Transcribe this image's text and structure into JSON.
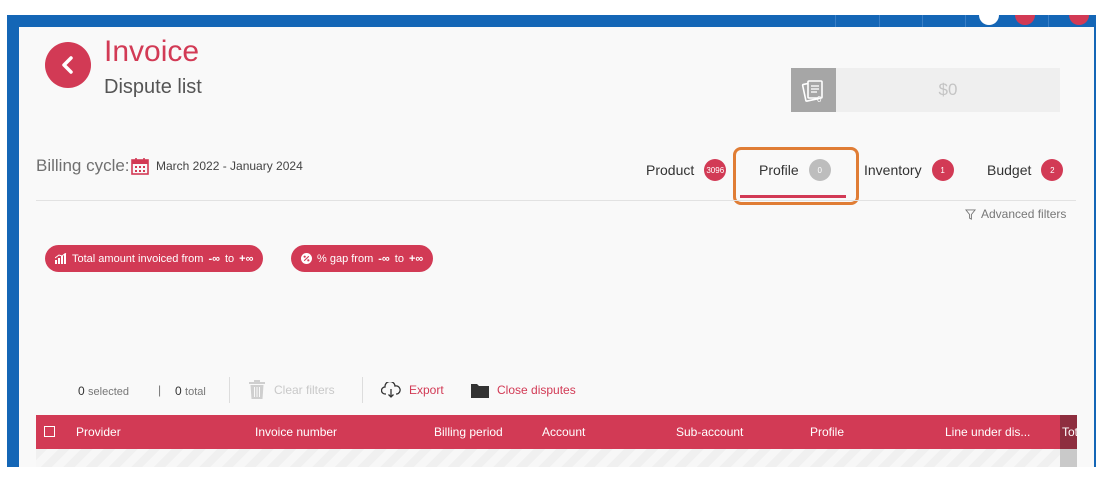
{
  "header": {
    "title": "Invoice",
    "subtitle": "Dispute list",
    "amount": "$0",
    "amount_icon_count": "0"
  },
  "billing": {
    "label": "Billing cycle:",
    "value": "March 2022 - January 2024"
  },
  "tabs": [
    {
      "label": "Product",
      "badge": "3096",
      "active": false
    },
    {
      "label": "Profile",
      "badge": "0",
      "active": true
    },
    {
      "label": "Inventory",
      "badge": "1",
      "active": false
    },
    {
      "label": "Budget",
      "badge": "2",
      "active": false
    }
  ],
  "advanced_filters": "Advanced filters",
  "chips": [
    {
      "label": "Total amount invoiced from",
      "from": "-∞",
      "to_word": "to",
      "to": "+∞"
    },
    {
      "label": "% gap from",
      "from": "-∞",
      "to_word": "to",
      "to": "+∞"
    }
  ],
  "toolbar": {
    "selected_count": "0",
    "selected_label": "selected",
    "total_count": "0",
    "total_label": "total",
    "pipe": "|",
    "clear_filters": "Clear filters",
    "export": "Export",
    "close_disputes": "Close disputes"
  },
  "table": {
    "columns": [
      "Provider",
      "Invoice number",
      "Billing period",
      "Account",
      "Sub-account",
      "Profile",
      "Line under dis...",
      "Tot"
    ]
  },
  "colors": {
    "accent": "#d23a55",
    "frame": "#1466b6",
    "highlight": "#e07d35"
  }
}
